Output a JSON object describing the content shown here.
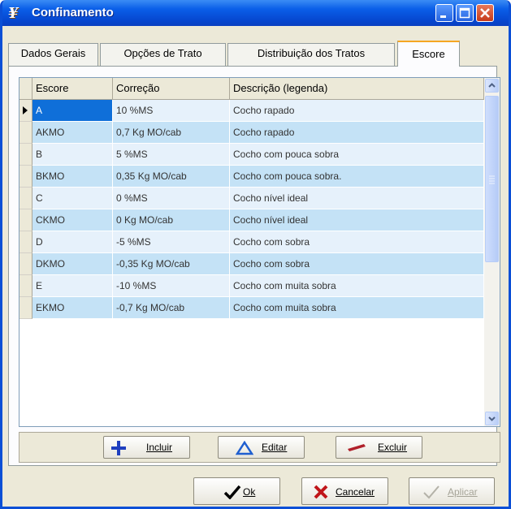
{
  "window": {
    "title": "Confinamento",
    "icon": "app-logo-icon"
  },
  "tabs": [
    {
      "label": "Dados Gerais",
      "active": false
    },
    {
      "label": "Opções de Trato",
      "active": false
    },
    {
      "label": "Distribuição dos Tratos",
      "active": false
    },
    {
      "label": "Escore",
      "active": true
    }
  ],
  "grid": {
    "columns": [
      "Escore",
      "Correção",
      "Descrição (legenda)"
    ],
    "rows": [
      {
        "escore": "A",
        "correcao": "10 %MS",
        "descricao": "Cocho rapado",
        "selected": true
      },
      {
        "escore": "AKMO",
        "correcao": "0,7 Kg MO/cab",
        "descricao": "Cocho rapado"
      },
      {
        "escore": "B",
        "correcao": "5 %MS",
        "descricao": "Cocho com pouca sobra"
      },
      {
        "escore": "BKMO",
        "correcao": "0,35 Kg MO/cab",
        "descricao": "Cocho com pouca sobra."
      },
      {
        "escore": "C",
        "correcao": "0 %MS",
        "descricao": "Cocho nível ideal"
      },
      {
        "escore": "CKMO",
        "correcao": "0 Kg MO/cab",
        "descricao": "Cocho nível ideal"
      },
      {
        "escore": "D",
        "correcao": "-5 %MS",
        "descricao": "Cocho com sobra"
      },
      {
        "escore": "DKMO",
        "correcao": "-0,35 Kg MO/cab",
        "descricao": "Cocho com sobra"
      },
      {
        "escore": "E",
        "correcao": "-10 %MS",
        "descricao": "Cocho com muita sobra"
      },
      {
        "escore": "EKMO",
        "correcao": "-0,7 Kg MO/cab",
        "descricao": "Cocho com muita sobra"
      }
    ]
  },
  "grid_buttons": {
    "incluir": {
      "label": "Incluir",
      "icon": "plus-icon"
    },
    "editar": {
      "label": "Editar",
      "icon": "triangle-edit-icon"
    },
    "excluir": {
      "label": "Excluir",
      "icon": "minus-icon"
    }
  },
  "dialog_buttons": {
    "ok": {
      "label": "Ok",
      "icon": "checkmark-icon"
    },
    "cancelar": {
      "label": "Cancelar",
      "icon": "x-cancel-icon"
    },
    "aplicar": {
      "label": "Aplicar",
      "icon": "checkmark-icon",
      "disabled": true
    }
  },
  "colors": {
    "titlebar": "#0a5ee8",
    "row_light": "#e6f1fb",
    "row_dark": "#c4e2f6",
    "selected_cell": "#0f6fd9",
    "active_tab_accent": "#f5a623"
  }
}
